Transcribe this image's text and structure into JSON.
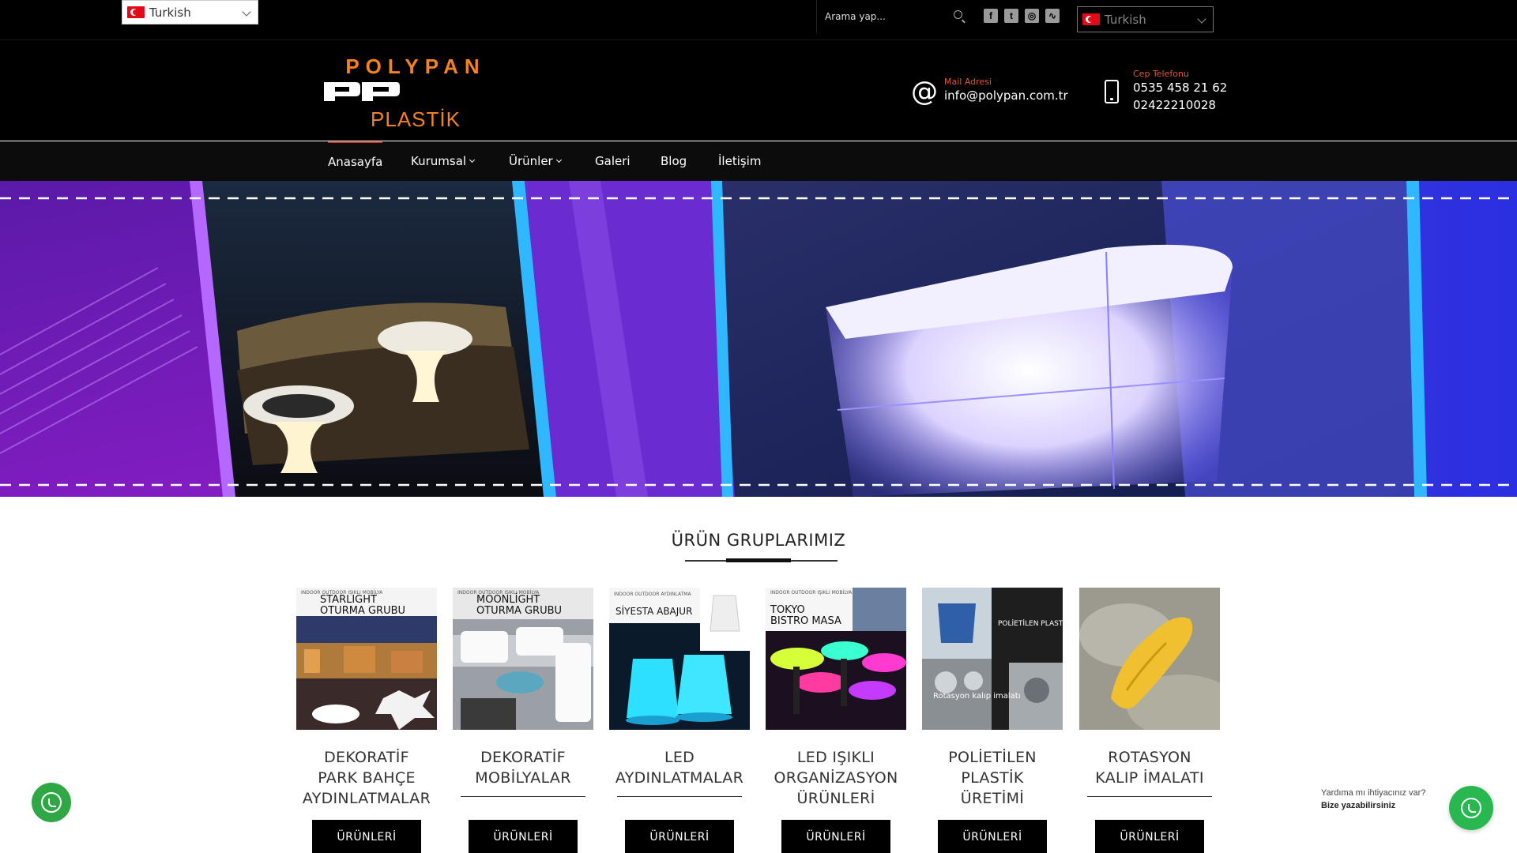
{
  "topbar": {
    "language_left": "Turkish",
    "search_placeholder": "Arama yap...",
    "social": [
      "f",
      "t",
      "◎",
      "∿"
    ],
    "language_right": "Turkish"
  },
  "header": {
    "logo": {
      "line1": "POLYPAN",
      "line3": "PLASTİK"
    },
    "mail_label": "Mail Adresi",
    "mail_value": "info@polypan.com.tr",
    "phone_label": "Cep Telefonu",
    "phone_1": "0535 458 21 62",
    "phone_2": "02422210028"
  },
  "nav": {
    "items": [
      {
        "label": "Anasayfa"
      },
      {
        "label": "Kurumsal"
      },
      {
        "label": "Ürünler"
      },
      {
        "label": "Galeri"
      },
      {
        "label": "Blog"
      },
      {
        "label": "İletişim"
      }
    ]
  },
  "section": {
    "title": "ÜRÜN GRUPLARIMIZ"
  },
  "cards": [
    {
      "img_small": "INDOOR OUTDOOR IŞIKLI MOBİLYA",
      "img_big1": "STARLIGHT",
      "img_big2": "OTURMA GRUBU",
      "title": [
        "DEKORATİF",
        "PARK BAHÇE",
        "AYDINLATMALAR"
      ],
      "button": "ÜRÜNLERİ"
    },
    {
      "img_small": "INDOOR OUTDOOR IŞIKLI MOBİLYA",
      "img_big1": "MOONLİGHT",
      "img_big2": "OTURMA GRUBU",
      "title": [
        "DEKORATİF",
        "MOBİLYALAR"
      ],
      "button": "ÜRÜNLERİ"
    },
    {
      "img_small": "INDOOR OUTDOOR AYDINLATMA",
      "img_big1": "SİYESTA ABAJUR",
      "img_big2": "",
      "title": [
        "LED",
        "AYDINLATMALAR"
      ],
      "button": "ÜRÜNLERİ"
    },
    {
      "img_small": "INDOOR OUTDOOR IŞIKLI MOBİLYA",
      "img_big1": "TOKYO",
      "img_big2": "BISTRO MASA",
      "title": [
        "LED IŞIKLI",
        "ORGANİZASYON",
        "ÜRÜNLERİ"
      ],
      "button": "ÜRÜNLERİ"
    },
    {
      "img_small": "",
      "img_big1": "POLİETİLEN PLASTİK ÜRETİMİ",
      "img_big2": "Rotasyon kalıp imalatı",
      "title": [
        "POLİETİLEN",
        "PLASTİK",
        "ÜRETİMİ"
      ],
      "button": "ÜRÜNLERİ"
    },
    {
      "img_small": "",
      "img_big1": "",
      "img_big2": "",
      "title": [
        "ROTASYON",
        "KALIP İMALATI"
      ],
      "button": "ÜRÜNLERİ"
    }
  ],
  "whatsapp": {
    "help_line1": "Yardıma mı ihtiyacınız var?",
    "help_line2": "Bize yazabilirsiniz"
  }
}
